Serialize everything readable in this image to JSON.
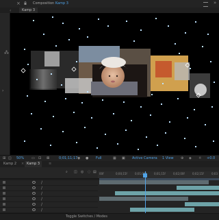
{
  "topbar": {
    "close_glyph": "×",
    "panel_prefix": "Composition",
    "comp_name": "Kamp 3",
    "menu_glyph": "»"
  },
  "comp_tab": "Kamp 3",
  "viewer_footer": {
    "zoom": "50%",
    "timecode": "0;01;11;17",
    "resolution": "Full",
    "camera": "Active Camera",
    "views": "1 View",
    "offset": "+0.0"
  },
  "timeline": {
    "tabs": [
      "Kamp 2",
      "Kamp 3"
    ],
    "active_tab": "Kamp 3",
    "ruler_labels": [
      "00f",
      "0;00;15f",
      "0;01;00f",
      "0;01;15f",
      "0;02;00f",
      "0;02;15f",
      "0;03"
    ],
    "footer_label": "Toggle Switches / Modes"
  },
  "colors": {
    "accent_blue": "#4fa3e8",
    "track_teal": "#6ea3a8",
    "track_gray": "#5e6b70",
    "viewer_bg": "#000000"
  },
  "icons": [
    "close-icon",
    "lock-icon",
    "menu-icon",
    "flow-icon",
    "eye-icon",
    "camera-icon",
    "region-icon",
    "grid-icon"
  ]
}
